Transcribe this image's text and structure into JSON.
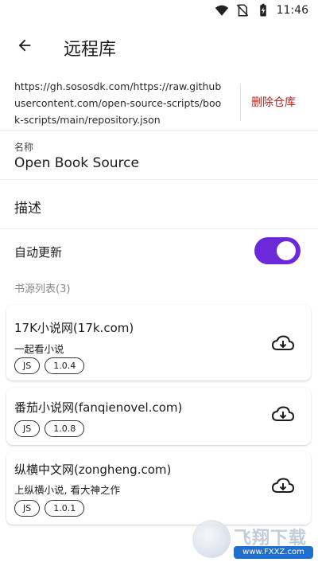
{
  "status_bar": {
    "time": "11:46",
    "icons": [
      "wifi-icon",
      "no-sim-icon",
      "battery-charging-icon"
    ]
  },
  "app_bar": {
    "title": "远程库",
    "back_icon": "arrow-left-icon"
  },
  "repository": {
    "url": "https://gh.sososdk.com/https://raw.githubusercontent.com/open-source-scripts/book-scripts/main/repository.json",
    "delete_label": "删除仓库",
    "delete_color": "#b3261e"
  },
  "fields": {
    "name_label": "名称",
    "name_value": "Open Book Source",
    "description_label": "描述",
    "auto_update_label": "自动更新",
    "auto_update_on": true,
    "toggle_color": "#6d28d9"
  },
  "sources": {
    "header": "书源列表(3)",
    "items": [
      {
        "title": "17K小说网(17k.com)",
        "description": "一起看小说",
        "tags": [
          "JS",
          "1.0.4"
        ]
      },
      {
        "title": "番茄小说网(fanqienovel.com)",
        "description": "",
        "tags": [
          "JS",
          "1.0.8"
        ]
      },
      {
        "title": "纵横中文网(zongheng.com)",
        "description": "上纵横小说, 看大神之作",
        "tags": [
          "JS",
          "1.0.1"
        ]
      }
    ]
  },
  "watermark": {
    "brand": "飞翔下载",
    "site": "www.FXXZ.com"
  }
}
